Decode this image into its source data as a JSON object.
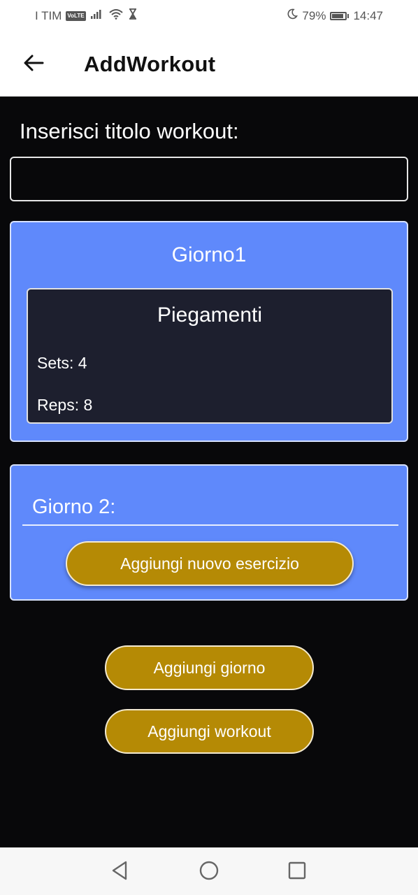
{
  "status_bar": {
    "carrier": "I TIM",
    "volte": "VoLTE",
    "battery": "79%",
    "battery_level": 0.79,
    "time": "14:47",
    "icons": [
      "signal-icon",
      "wifi-icon",
      "hourglass-icon",
      "moon-icon",
      "battery-icon"
    ]
  },
  "app_bar": {
    "title": "AddWorkout",
    "back_icon": "arrow-left-icon"
  },
  "form": {
    "title_label": "Inserisci titolo workout:",
    "title_value": "",
    "title_placeholder": ""
  },
  "days": [
    {
      "title": "Giorno1",
      "exercises": [
        {
          "name": "Piegamenti",
          "sets": "Sets: 4",
          "reps": "Reps: 8"
        }
      ]
    },
    {
      "title_value": "Giorno 2:",
      "add_exercise_label": "Aggiungi nuovo esercizio"
    }
  ],
  "actions": {
    "add_day_label": "Aggiungi giorno",
    "add_workout_label": "Aggiungi workout"
  },
  "nav_bar": {
    "icons": [
      "nav-back-icon",
      "nav-home-icon",
      "nav-recent-icon"
    ]
  },
  "colors": {
    "background": "#08080a",
    "day_card": "#5f89fb",
    "exercise_card": "#1d1f2e",
    "button_gold": "#b58a05",
    "app_bar": "#ffffff"
  }
}
